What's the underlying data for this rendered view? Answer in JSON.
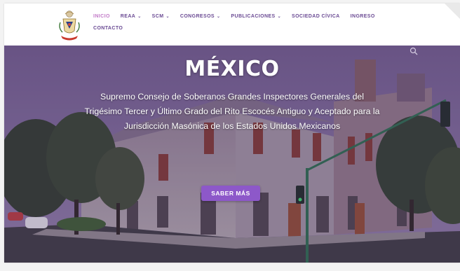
{
  "nav": {
    "items": [
      {
        "label": "INICIO",
        "caret": false
      },
      {
        "label": "REAA",
        "caret": true
      },
      {
        "label": "SCM",
        "caret": true
      },
      {
        "label": "CONGRESOS",
        "caret": true
      },
      {
        "label": "PUBLICACIONES",
        "caret": true
      },
      {
        "label": "SOCIEDAD CÍVICA",
        "caret": false
      },
      {
        "label": "INGRESO",
        "caret": false
      },
      {
        "label": "CONTACTO",
        "caret": false
      }
    ],
    "caret_glyph": "⌄",
    "active_color": "#c27ac8",
    "link_color": "#6a4a93"
  },
  "hero": {
    "title": "MÉXICO",
    "subtitle": "Supremo Consejo de Soberanos Grandes Inspectores Generales del Trigésimo Tercer y Último Grado del Rito Escocés Antiguo y Aceptado para la Jurisdicción Masónica de los Estados Unidos Mexicanos",
    "button_label": "SABER MÁS",
    "button_color": "#8d58c9"
  },
  "icons": {
    "logo": "masonic-crest-icon",
    "search": "search-icon"
  }
}
